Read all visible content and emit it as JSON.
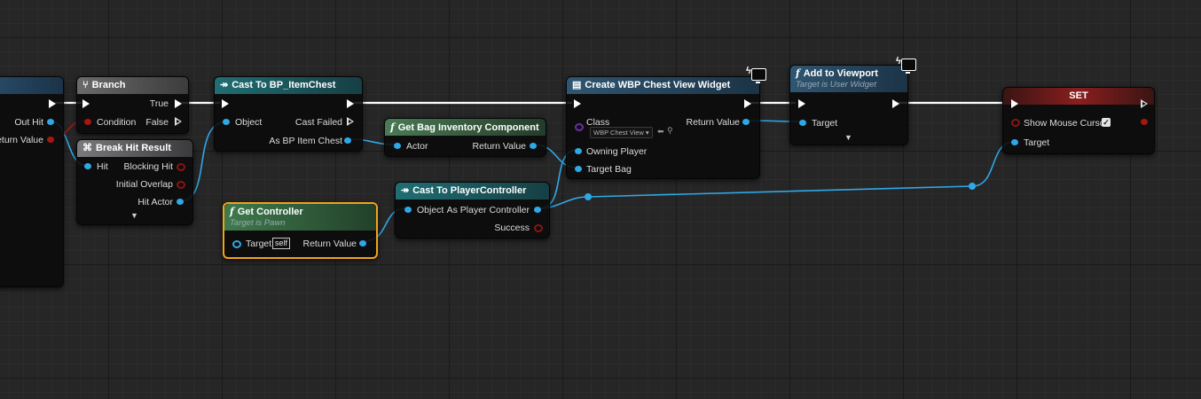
{
  "colors": {
    "exec_wire": "#ffffff",
    "object_wire": "#2fa8e8",
    "bool_wire": "#a81515",
    "branch_header": "#5a5a5a",
    "cast_header": "#1f5e64",
    "function_header_green": "#3d6b48",
    "function_header_blue": "#2d4f6a",
    "break_header": "#58585a",
    "set_header": "#7a1a1a",
    "selection_outline": "#f2a21c"
  },
  "nodes": {
    "left_partial": {
      "pins": [
        "Out Hit",
        "eturn Value"
      ]
    },
    "branch": {
      "icon": "branch-icon",
      "title": "Branch",
      "condition": "Condition",
      "true_label": "True",
      "false_label": "False"
    },
    "break_hit": {
      "icon": "break-struct-icon",
      "title": "Break Hit Result",
      "hit": "Hit",
      "blocking_hit": "Blocking Hit",
      "initial_overlap": "Initial Overlap",
      "hit_actor": "Hit Actor"
    },
    "cast_chest": {
      "icon": "cast-arrow-icon",
      "title": "Cast To BP_ItemChest",
      "object": "Object",
      "cast_failed": "Cast Failed",
      "as_output": "As BP Item Chest"
    },
    "get_controller": {
      "glyph": "f",
      "title": "Get Controller",
      "subtitle": "Target is Pawn",
      "target": "Target",
      "self_value": "self",
      "return_value": "Return Value"
    },
    "get_bag": {
      "glyph": "f",
      "title": "Get Bag Inventory Component",
      "actor": "Actor",
      "return_value": "Return Value"
    },
    "cast_pc": {
      "icon": "cast-arrow-icon",
      "title": "Cast To PlayerController",
      "object": "Object",
      "as_output": "As Player Controller",
      "success": "Success"
    },
    "create_widget": {
      "icon": "widget-icon",
      "title": "Create WBP Chest View Widget",
      "class_label": "Class",
      "class_value": "WBP Chest View",
      "return_value": "Return Value",
      "owning_player": "Owning Player",
      "target_bag": "Target Bag"
    },
    "add_viewport": {
      "glyph": "f",
      "title": "Add to Viewport",
      "subtitle": "Target is User Widget",
      "target": "Target"
    },
    "set_node": {
      "title": "SET",
      "show_mouse_cursor": "Show Mouse Cursor",
      "target": "Target",
      "show_mouse_cursor_checked": true
    }
  }
}
